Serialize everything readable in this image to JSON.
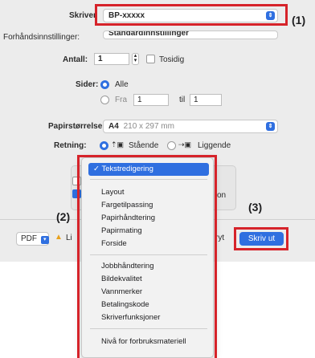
{
  "printer": {
    "label": "Skriver",
    "value": "BP-xxxxx"
  },
  "presets": {
    "label": "Forhåndsinnstillinger:",
    "value": "Standardinnstillinger"
  },
  "copies": {
    "label": "Antall:",
    "value": "1",
    "two_sided_label": "Tosidig"
  },
  "pages": {
    "label": "Sider:",
    "all_label": "Alle",
    "from_label": "Fra",
    "from_value": "1",
    "to_label": "til",
    "to_value": "1"
  },
  "paper_size": {
    "label": "Papirstørrelse:",
    "value": "A4",
    "dims": "210 x 297 mm"
  },
  "orientation": {
    "label": "Retning:",
    "portrait_label": "Stående",
    "landscape_label": "Liggende"
  },
  "menu": {
    "selected": "Tekstredigering",
    "group1": [
      "Layout",
      "Fargetilpassing",
      "Papirhåndtering",
      "Papirmating",
      "Forside"
    ],
    "group2": [
      "Jobbhåndtering",
      "Bildekvalitet",
      "Vannmerker",
      "Betalingskode",
      "Skriverfunksjoner"
    ],
    "group3": [
      "Nivå for forbruksmateriell"
    ]
  },
  "hidden_text": {
    "right_fragment": "on",
    "warning_fragment": "Li",
    "cancel_fragment": "ryt"
  },
  "footer": {
    "pdf_label": "PDF",
    "print_label": "Skriv ut"
  },
  "callouts": {
    "c1": "(1)",
    "c2": "(2)",
    "c3": "(3)"
  },
  "colors": {
    "accent": "#2f6fe0",
    "callout_red": "#d6232a"
  }
}
